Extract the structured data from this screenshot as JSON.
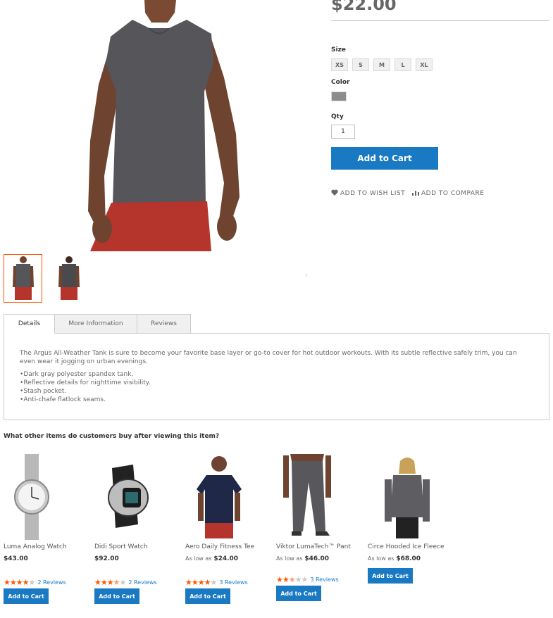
{
  "product": {
    "price": "$22.00",
    "size_label": "Size",
    "sizes": [
      "XS",
      "S",
      "M",
      "L",
      "XL"
    ],
    "color_label": "Color",
    "color_value": "#8c8c8c",
    "qty_label": "Qty",
    "qty_value": "1",
    "add_to_cart": "Add to Cart",
    "wishlist": "ADD TO WISH LIST",
    "compare": "ADD TO COMPARE"
  },
  "gallery": {
    "next": "›"
  },
  "tabs": {
    "items": [
      {
        "label": "Details"
      },
      {
        "label": "More Information"
      },
      {
        "label": "Reviews"
      }
    ],
    "details_text": "The Argus All-Weather Tank is sure to become your favorite base layer or go-to cover for hot outdoor workouts. With its subtle reflective safely trim, you can even wear it jogging on urban evenings.",
    "bullets": [
      "Dark gray polyester spandex tank.",
      "Reflective details for nighttime visibility.",
      "Stash pocket.",
      "Anti-chafe flatlock seams."
    ]
  },
  "related": {
    "title": "What other items do customers buy after viewing this item?",
    "products": [
      {
        "name": "Luma Analog Watch",
        "price_prefix": "",
        "price": "$43.00",
        "rating_stars": 4,
        "reviews": "2 Reviews",
        "button": "Add to Cart"
      },
      {
        "name": "Didi Sport Watch",
        "price_prefix": "",
        "price": "$92.00",
        "rating_stars": 3.5,
        "reviews": "2 Reviews",
        "button": "Add to Cart"
      },
      {
        "name": "Aero Daily Fitness Tee",
        "price_prefix": "As low as",
        "price": "$24.00",
        "rating_stars": 4,
        "reviews": "3 Reviews",
        "button": "Add to Cart"
      },
      {
        "name": "Viktor LumaTech™ Pant",
        "price_prefix": "As low as",
        "price": "$46.00",
        "rating_stars": 2.5,
        "reviews": "3 Reviews",
        "button": "Add to Cart"
      },
      {
        "name": "Circe Hooded Ice Fleece",
        "price_prefix": "As low as",
        "price": "$68.00",
        "rating_stars": 0,
        "reviews": "",
        "button": "Add to Cart"
      }
    ]
  }
}
